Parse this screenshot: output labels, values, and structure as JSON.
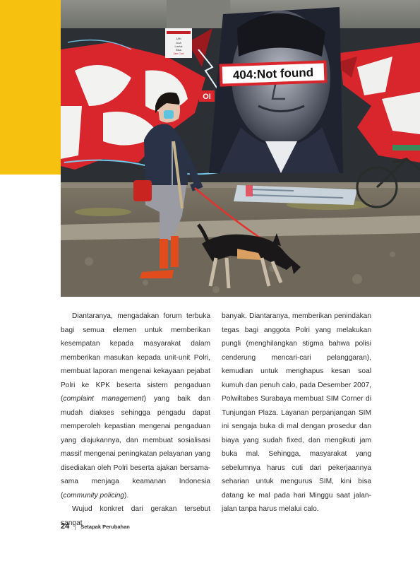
{
  "photo": {
    "banner_text": "404:Not found",
    "tag_text": "OI",
    "poster_lines": [
      "JAN",
      "Dua",
      "Lantai",
      "Bisa",
      "Jam Cuci",
      "SPORT",
      "081234567"
    ]
  },
  "body": {
    "left_column": {
      "p1_a": "Diantaranya, mengadakan forum terbuka bagi semua elemen untuk memberikan kesempatan kepada masyarakat dalam memberikan masukan kepada unit-unit Polri, membuat laporan mengenai kekayaan pejabat Polri ke KPK beserta sistem pengaduan (",
      "p1_em1": "complaint management",
      "p1_b": ") yang baik dan mudah diakses sehingga pengadu dapat memperoleh kepastian mengenai pengaduan yang diajukannya, dan membuat sosialisasi massif mengenai peningkatan pelayanan yang disediakan oleh Polri beserta ajakan bersama-sama menjaga keamanan Indonesia (",
      "p1_em2": "community policing",
      "p1_c": ").",
      "p2": "Wujud konkret dari gerakan tersebut sangat"
    },
    "right_column": {
      "text": "banyak. Diantaranya, memberikan penindakan tegas bagi anggota Polri yang melakukan pungli (menghilangkan stigma bahwa polisi cenderung mencari-cari pelanggaran), kemudian untuk menghapus kesan soal kumuh dan penuh calo, pada Desember 2007, Polwiltabes Surabaya membuat SIM Corner di Tunjungan Plaza. Layanan perpanjangan SIM ini sengaja buka di mal dengan prosedur dan biaya yang sudah fixed, dan mengikuti jam buka mal. Sehingga, masyarakat yang sebelumnya harus cuti dari pekerjaannya seharian untuk mengurus SIM, kini bisa datang ke mal pada hari Minggu saat jalan-jalan tanpa harus melalui calo."
    }
  },
  "footer": {
    "page_number": "24",
    "section_title": "Setapak Perubahan"
  },
  "colors": {
    "accent_yellow": "#f6c20f",
    "graffiti_red": "#d8262c",
    "text": "#2d2d2d"
  }
}
